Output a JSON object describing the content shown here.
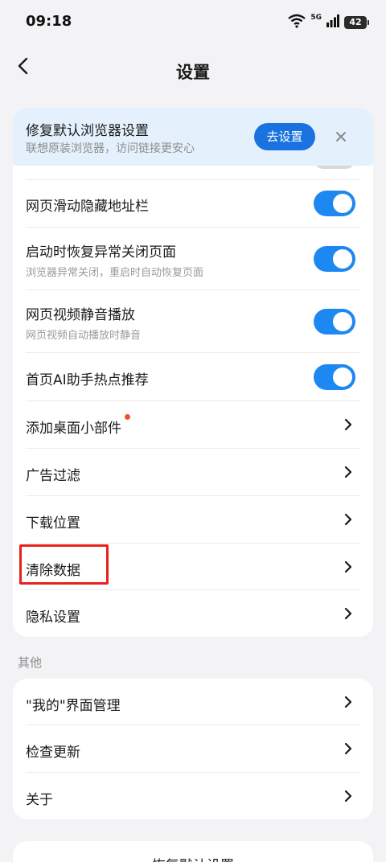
{
  "status_bar": {
    "time": "09:18",
    "network": "5G",
    "battery": "42"
  },
  "nav": {
    "title": "设置"
  },
  "banner": {
    "title": "修复默认浏览器设置",
    "subtitle": "联想原装浏览器，访问链接更安心",
    "button_label": "去设置"
  },
  "main_items": [
    {
      "title": "",
      "toggle": "partial"
    },
    {
      "title": "网页滑动隐藏地址栏",
      "toggle": true
    },
    {
      "title": "启动时恢复异常关闭页面",
      "subtitle": "浏览器异常关闭，重启时自动恢复页面",
      "toggle": true
    },
    {
      "title": "网页视频静音播放",
      "subtitle": "网页视频自动播放时静音",
      "toggle": true
    },
    {
      "title": "首页AI助手热点推荐",
      "toggle": true
    },
    {
      "title": "添加桌面小部件",
      "badge": "red-dot"
    },
    {
      "title": "广告过滤"
    },
    {
      "title": "下载位置"
    },
    {
      "title": "清除数据",
      "highlighted": true
    },
    {
      "title": "隐私设置"
    }
  ],
  "section_other": {
    "label": "其他"
  },
  "other_items": [
    {
      "title": "\"我的\"界面管理"
    },
    {
      "title": "检查更新"
    },
    {
      "title": "关于"
    }
  ],
  "bottom": {
    "label": "恢复默认设置"
  },
  "colors": {
    "accent": "#1e88f2",
    "banner_bg": "#e4f1fd",
    "highlight": "#e8211c",
    "badge": "#f0522d"
  },
  "icons": [
    "back-arrow-icon",
    "wifi-icon",
    "signal-icon",
    "battery-icon",
    "close-icon",
    "chevron-right-icon"
  ]
}
